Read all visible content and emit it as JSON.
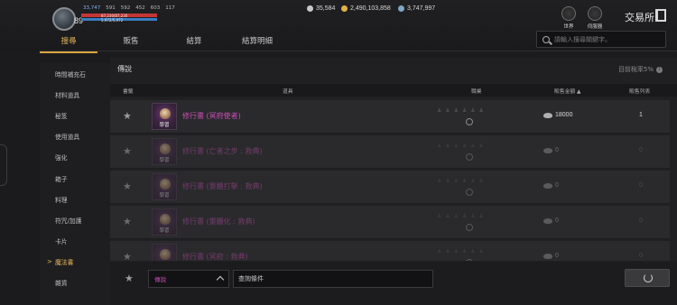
{
  "player": {
    "level": "89",
    "stat1": "33,747",
    "stat2": "591",
    "stat3": "592",
    "stat4": "452",
    "stat5": "603",
    "stat6": "117",
    "hp_text": "87,230/87,230",
    "mp_text": "5,972/5,972",
    "hp_fraction": 1.0,
    "mp_fraction": 1.0
  },
  "currencies": [
    {
      "icon": "silver-diamond-icon",
      "value": "35,584",
      "color": "#c8c8c8"
    },
    {
      "icon": "gold-coin-icon",
      "value": "2,490,103,858",
      "color": "#e2b24a"
    },
    {
      "icon": "blue-gem-icon",
      "value": "3,747,997",
      "color": "#7fa7c4"
    }
  ],
  "top_icons": {
    "world": "世界",
    "server": "伺服器"
  },
  "exchange_title": "交易所",
  "tabs": [
    "搜尋",
    "販售",
    "結算",
    "結算明細"
  ],
  "search": {
    "placeholder": "請輸入搜尋關鍵字。"
  },
  "sidebar": {
    "items": [
      "時間補充石",
      "材料道具",
      "秘笈",
      "使用道具",
      "強化",
      "箱子",
      "料理",
      "符咒/加護",
      "卡片",
      "魔法書",
      "雜貨"
    ],
    "active_index": 9
  },
  "panel": {
    "title": "傳說",
    "tax_label": "目前稅率5%"
  },
  "table": {
    "headers": {
      "fav": "書籤",
      "item": "道具",
      "trait": "職業",
      "price": "販售金額 ▲",
      "count": "販售列表"
    },
    "rows": [
      {
        "name": "修行書 (冥府使者)",
        "thumb_label": "學習",
        "price": "18000",
        "count": "1",
        "dim": false
      },
      {
        "name": "修行書 (亡者之步 : 救典)",
        "thumb_label": "學習",
        "price": "0",
        "count": "0",
        "dim": true
      },
      {
        "name": "修行書 (靈體打擊 : 救典)",
        "thumb_label": "學習",
        "price": "0",
        "count": "0",
        "dim": true
      },
      {
        "name": "修行書 (靈體化 : 救典)",
        "thumb_label": "學習",
        "price": "0",
        "count": "0",
        "dim": true
      },
      {
        "name": "修行書 (冥府 : 救典)",
        "thumb_label": "學習",
        "price": "0",
        "count": "0",
        "dim": true
      }
    ]
  },
  "bottom": {
    "grade_select": "傳說",
    "condition_label": "查詢條件"
  }
}
